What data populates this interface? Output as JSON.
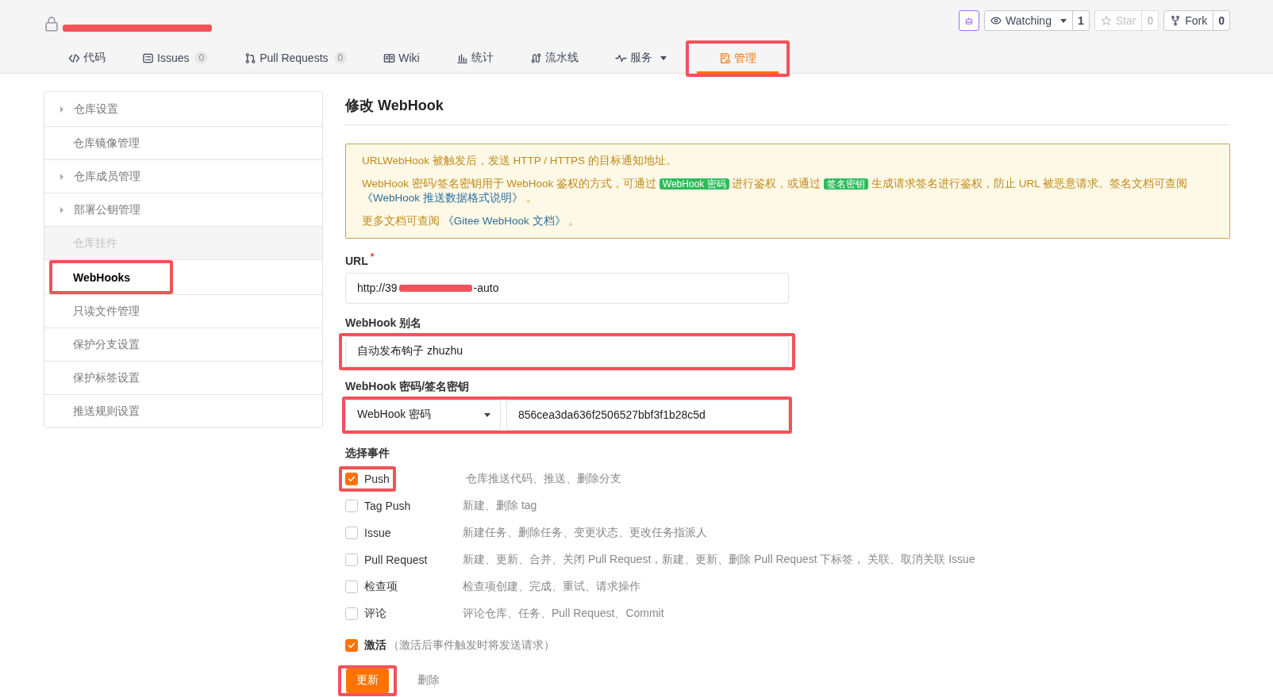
{
  "repo": {
    "private": true,
    "title_redacted": true
  },
  "header_buttons": [
    {
      "kind": "bot"
    },
    {
      "kind": "watch",
      "label": "Watching",
      "count": "1",
      "disabled": false
    },
    {
      "kind": "star",
      "label": "Star",
      "count": "0",
      "disabled": true
    },
    {
      "kind": "fork",
      "label": "Fork",
      "count": "0",
      "disabled": false
    }
  ],
  "nav_tabs": [
    {
      "kind": "code",
      "label": "代码",
      "selected": false
    },
    {
      "kind": "issues",
      "label": "Issues",
      "count": "0",
      "selected": false
    },
    {
      "kind": "pr",
      "label": "Pull Requests",
      "count": "0",
      "selected": false
    },
    {
      "kind": "wiki",
      "label": "Wiki",
      "selected": false
    },
    {
      "kind": "stats",
      "label": "统计",
      "selected": false
    },
    {
      "kind": "pipeline",
      "label": "流水线",
      "selected": false
    },
    {
      "kind": "service",
      "label": "服务",
      "dropdown": true,
      "selected": false
    },
    {
      "kind": "manage",
      "label": "管理",
      "selected": true,
      "annotated": true
    }
  ],
  "sidebar": {
    "items": [
      {
        "label": "仓库设置",
        "expandable": true,
        "disabled": false,
        "selected": false
      },
      {
        "label": "仓库镜像管理",
        "disabled": false,
        "selected": false
      },
      {
        "label": "仓库成员管理",
        "expandable": true,
        "disabled": false,
        "selected": false
      },
      {
        "label": "部署公钥管理",
        "expandable": true,
        "disabled": false,
        "selected": false
      },
      {
        "label": "仓库挂件",
        "disabled": true,
        "selected": false
      },
      {
        "label": "WebHooks",
        "disabled": false,
        "selected": true,
        "annotated": true
      },
      {
        "label": "只读文件管理",
        "disabled": false,
        "selected": false
      },
      {
        "label": "保护分支设置",
        "disabled": false,
        "selected": false
      },
      {
        "label": "保护标签设置",
        "disabled": false,
        "selected": false
      },
      {
        "label": "推送规则设置",
        "disabled": false,
        "selected": false
      }
    ]
  },
  "page_title": "修改 WebHook",
  "notice": [
    [
      {
        "kind": "text",
        "text": "URLWebHook 被触发后，发送 HTTP / HTTPS 的目标通知地址。"
      }
    ],
    [
      {
        "kind": "text",
        "text": "WebHook 密码/签名密钥用于 WebHook 鉴权的方式，可通过 "
      },
      {
        "kind": "badge",
        "text": "WebHook 密码"
      },
      {
        "kind": "text",
        "text": " 进行鉴权，或通过 "
      },
      {
        "kind": "badge",
        "text": "签名密钥"
      },
      {
        "kind": "text",
        "text": " 生成请求签名进行鉴权，防止 URL 被恶意请求。签名文档可查阅 "
      },
      {
        "kind": "link",
        "text": "《WebHook 推送数据格式说明》"
      },
      {
        "kind": "text",
        "text": " 。"
      }
    ],
    [
      {
        "kind": "text",
        "text": "更多文档可查阅 "
      },
      {
        "kind": "link",
        "text": "《Gitee WebHook 文档》"
      },
      {
        "kind": "text",
        "text": " 。"
      }
    ]
  ],
  "url_field": {
    "label": "URL",
    "required_mark": "*",
    "value_start": "http://39",
    "value_end": "-auto",
    "redacted": true
  },
  "alias_field": {
    "label": "WebHook 别名",
    "value": "自动发布钩子 zhuzhu",
    "annotated": true
  },
  "secret_field": {
    "label": "WebHook 密码/签名密钥",
    "type_value": "WebHook 密码",
    "value": "856cea3da636f2506527bbf3f1b28c5d",
    "annotated": true
  },
  "events_title": "选择事件",
  "events": [
    {
      "name": "Push",
      "description": "仓库推送代码、推送、删除分支",
      "checked": true,
      "annotated": true
    },
    {
      "name": "Tag Push",
      "description": "新建、删除 tag",
      "checked": false
    },
    {
      "name": "Issue",
      "description": "新建任务、删除任务、变更状态、更改任务指派人",
      "checked": false
    },
    {
      "name": "Pull Request",
      "description": "新建、更新、合并、关闭 Pull Request，新建、更新、删除 Pull Request 下标签， 关联、取消关联 Issue",
      "checked": false
    },
    {
      "name": "检查项",
      "description": "检查项创建、完成、重试、请求操作",
      "checked": false
    },
    {
      "name": "评论",
      "description": "评论仓库、任务、Pull Request、Commit",
      "checked": false
    }
  ],
  "active": {
    "label": "激活",
    "note": "（激活后事件触发时将发送请求）",
    "checked": true
  },
  "buttons": [
    {
      "kind": "primary",
      "label": "更新",
      "annotated": true
    },
    {
      "kind": "link",
      "label": "删除"
    }
  ]
}
